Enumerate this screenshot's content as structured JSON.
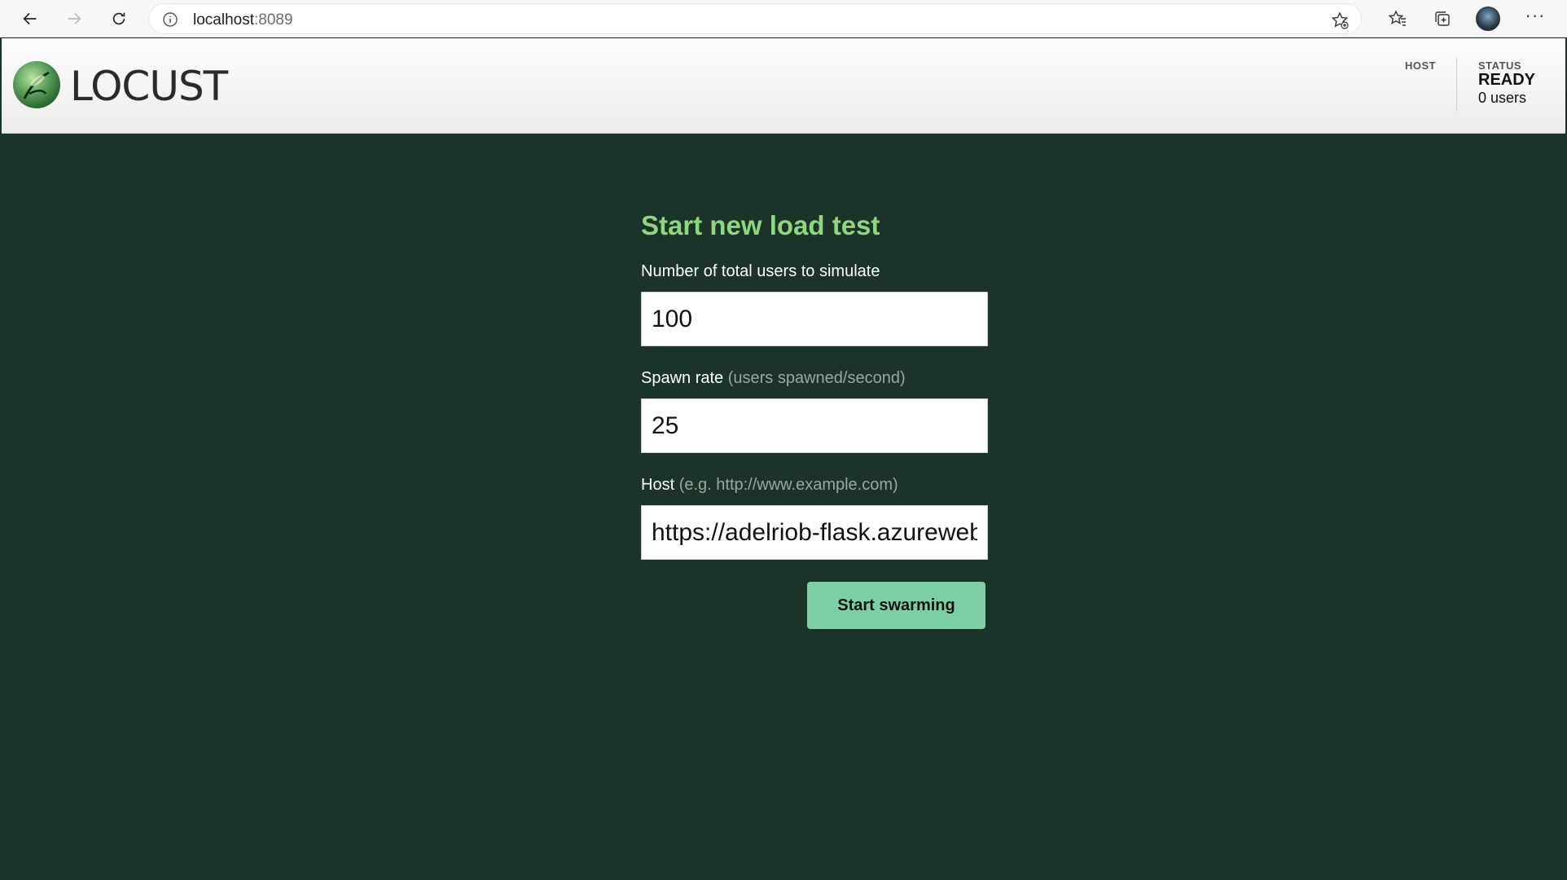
{
  "browser": {
    "url_host": "localhost",
    "url_port": ":8089"
  },
  "header": {
    "brand": "LOCUST",
    "host_label": "HOST",
    "status_label": "STATUS",
    "status_value": "READY",
    "users": "0 users"
  },
  "form": {
    "title": "Start new load test",
    "users_label": "Number of total users to simulate",
    "users_value": "100",
    "spawn_label": "Spawn rate",
    "spawn_hint": "(users spawned/second)",
    "spawn_value": "25",
    "host_label": "Host",
    "host_hint": "(e.g. http://www.example.com)",
    "host_value": "https://adelriob-flask.azurewebsites.net",
    "submit_label": "Start swarming"
  },
  "colors": {
    "background": "#1b3328",
    "title": "#8fd67f",
    "button": "#7ecfa6"
  },
  "icons": [
    "back-arrow-icon",
    "forward-arrow-icon",
    "refresh-icon",
    "info-icon",
    "add-favorite-icon",
    "favorites-icon",
    "collections-icon",
    "profile-avatar",
    "more-icon",
    "locust-logo"
  ]
}
